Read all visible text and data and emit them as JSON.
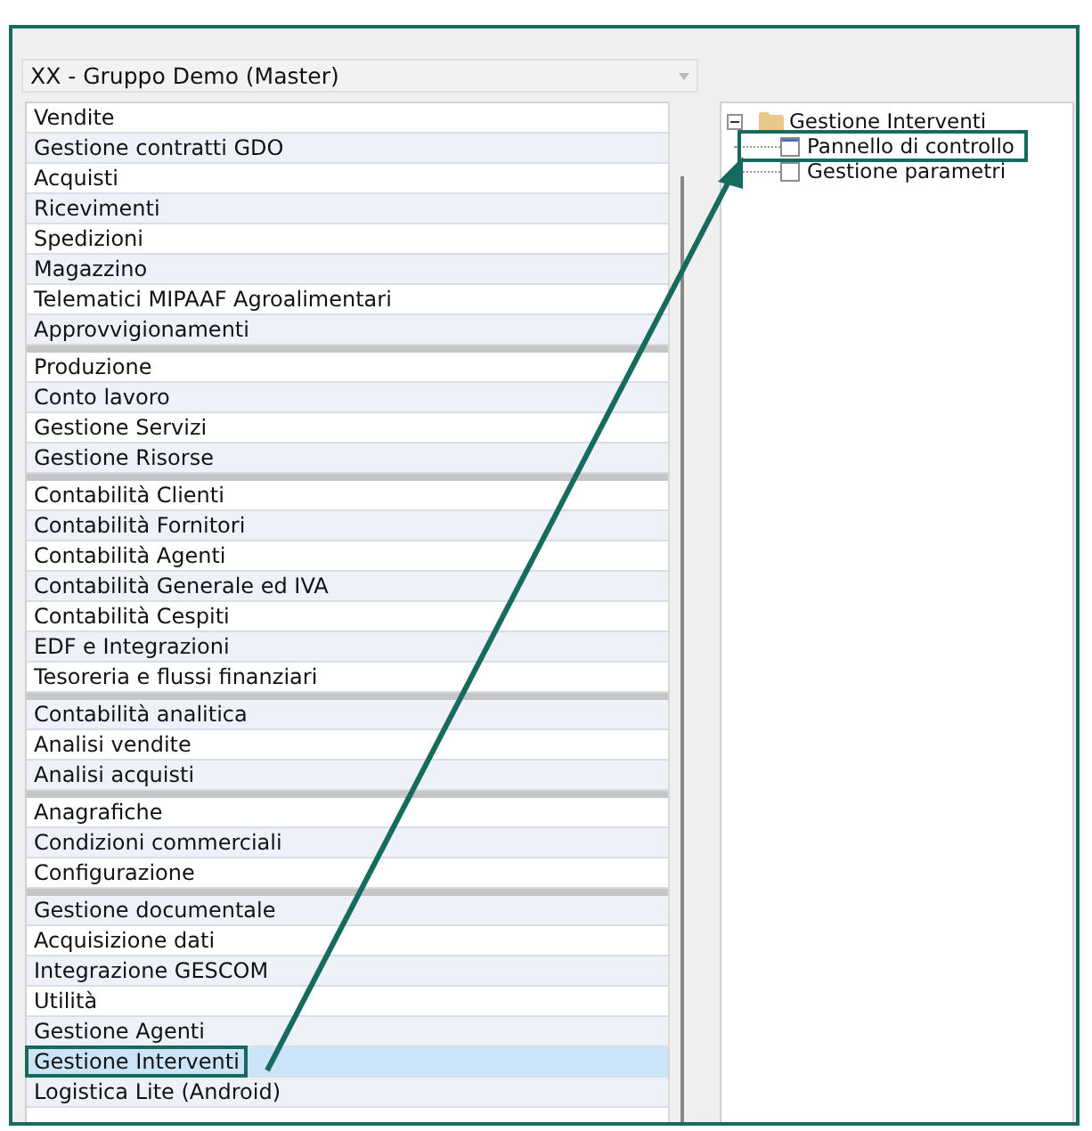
{
  "company_select": {
    "value": "XX - Gruppo Demo (Master)"
  },
  "module_groups": [
    {
      "items": [
        {
          "label": "Vendite",
          "selected": false,
          "highlighted": false
        },
        {
          "label": "Gestione contratti GDO",
          "selected": false,
          "highlighted": false
        },
        {
          "label": "Acquisti",
          "selected": false,
          "highlighted": false
        },
        {
          "label": "Ricevimenti",
          "selected": false,
          "highlighted": false
        },
        {
          "label": "Spedizioni",
          "selected": false,
          "highlighted": false
        },
        {
          "label": "Magazzino",
          "selected": false,
          "highlighted": false
        },
        {
          "label": "Telematici MIPAAF Agroalimentari",
          "selected": false,
          "highlighted": false
        },
        {
          "label": "Approvvigionamenti",
          "selected": false,
          "highlighted": false
        }
      ]
    },
    {
      "items": [
        {
          "label": "Produzione",
          "selected": false,
          "highlighted": false
        },
        {
          "label": "Conto lavoro",
          "selected": false,
          "highlighted": false
        },
        {
          "label": "Gestione Servizi",
          "selected": false,
          "highlighted": false
        },
        {
          "label": "Gestione Risorse",
          "selected": false,
          "highlighted": false
        }
      ]
    },
    {
      "items": [
        {
          "label": "Contabilità Clienti",
          "selected": false,
          "highlighted": false
        },
        {
          "label": "Contabilità Fornitori",
          "selected": false,
          "highlighted": false
        },
        {
          "label": "Contabilità Agenti",
          "selected": false,
          "highlighted": false
        },
        {
          "label": "Contabilità Generale ed IVA",
          "selected": false,
          "highlighted": false
        },
        {
          "label": "Contabilità Cespiti",
          "selected": false,
          "highlighted": false
        },
        {
          "label": "EDF e Integrazioni",
          "selected": false,
          "highlighted": false
        },
        {
          "label": "Tesoreria e flussi finanziari",
          "selected": false,
          "highlighted": false
        }
      ]
    },
    {
      "items": [
        {
          "label": "Contabilità analitica",
          "selected": false,
          "highlighted": false
        },
        {
          "label": "Analisi vendite",
          "selected": false,
          "highlighted": false
        },
        {
          "label": "Analisi acquisti",
          "selected": false,
          "highlighted": false
        }
      ]
    },
    {
      "items": [
        {
          "label": "Anagrafiche",
          "selected": false,
          "highlighted": false
        },
        {
          "label": "Condizioni commerciali",
          "selected": false,
          "highlighted": false
        },
        {
          "label": "Configurazione",
          "selected": false,
          "highlighted": false
        }
      ]
    },
    {
      "items": [
        {
          "label": "Gestione documentale",
          "selected": false,
          "highlighted": false
        },
        {
          "label": "Acquisizione dati",
          "selected": false,
          "highlighted": false
        },
        {
          "label": "Integrazione GESCOM",
          "selected": false,
          "highlighted": false
        },
        {
          "label": "Utilità",
          "selected": false,
          "highlighted": false
        },
        {
          "label": "Gestione Agenti",
          "selected": false,
          "highlighted": false
        },
        {
          "label": "Gestione Interventi",
          "selected": true,
          "highlighted": true
        },
        {
          "label": "Logistica Lite (Android)",
          "selected": false,
          "highlighted": false
        }
      ]
    }
  ],
  "tree": {
    "label": "Gestione Interventi",
    "expanded": true,
    "children": [
      {
        "label": "Pannello di controllo",
        "highlighted": true
      },
      {
        "label": "Gestione parametri",
        "highlighted": false
      }
    ]
  }
}
